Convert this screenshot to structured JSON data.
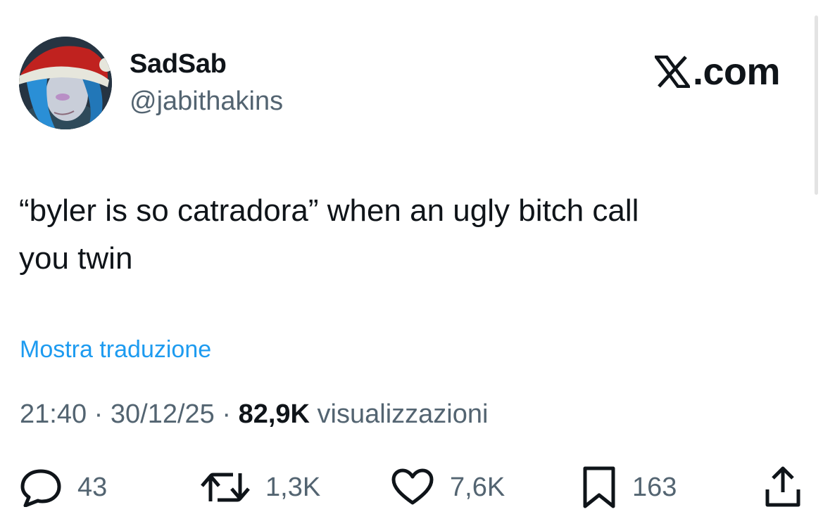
{
  "tweet": {
    "author": {
      "display_name": "SadSab",
      "handle": "@jabithakins"
    },
    "brand": ".com",
    "text_line1": "“byler is so catradora” when an ugly bitch call",
    "text_line2": "you twin",
    "translate_label": "Mostra traduzione",
    "time": "21:40",
    "date": "30/12/25",
    "separator": "·",
    "views_count": "82,9K",
    "views_label": "visualizzazioni",
    "stats": {
      "replies": "43",
      "reposts": "1,3K",
      "likes": "7,6K",
      "bookmarks": "163"
    }
  },
  "colors": {
    "text": "#0f1419",
    "secondary": "#536471",
    "link": "#1d9bf0"
  },
  "icons": [
    "x-logo-icon",
    "reply-icon",
    "repost-icon",
    "like-icon",
    "bookmark-icon",
    "share-icon"
  ]
}
